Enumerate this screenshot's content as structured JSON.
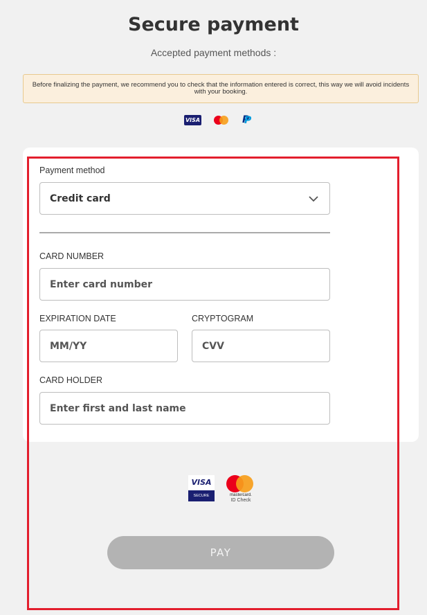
{
  "page": {
    "title": "Secure payment",
    "subtitle": "Accepted payment methods :"
  },
  "notice": {
    "text": "Before finalizing the payment, we recommend you to check that the information entered is correct, this way we will avoid incidents with your booking."
  },
  "accepted_methods": [
    {
      "name": "visa-icon",
      "text": "VISA"
    },
    {
      "name": "mastercard-icon"
    },
    {
      "name": "paypal-icon",
      "text": "P"
    }
  ],
  "form": {
    "payment_method": {
      "label": "Payment method",
      "value": "Credit card"
    },
    "card_number": {
      "label": "CARD NUMBER",
      "placeholder": "Enter card number"
    },
    "expiration": {
      "label": "EXPIRATION DATE",
      "placeholder": "MM/YY"
    },
    "cryptogram": {
      "label": "CRYPTOGRAM",
      "placeholder": "CVV"
    },
    "card_holder": {
      "label": "CARD HOLDER",
      "placeholder": "Enter first and last name"
    }
  },
  "secure_logos": {
    "visa_secure_top": "VISA",
    "visa_secure_bottom": "SECURE",
    "mc_line1": "mastercard.",
    "mc_line2": "ID Check"
  },
  "pay_button": {
    "label": "PAY"
  },
  "colors": {
    "highlight": "#e31e2d",
    "notice_bg": "#fbefdd",
    "pay_disabled": "#b3b3b3"
  }
}
